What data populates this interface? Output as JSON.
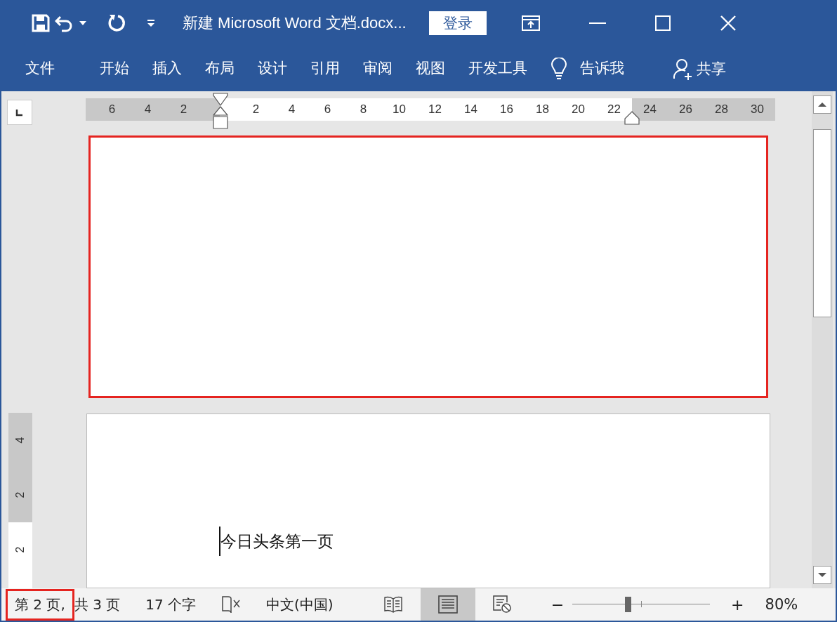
{
  "title_bar": {
    "title": "新建 Microsoft Word 文档.docx...",
    "sign_in": "登录"
  },
  "ribbon": {
    "tabs": [
      {
        "label": "文件",
        "selected": false
      },
      {
        "label": "开始",
        "selected": false
      },
      {
        "label": "插入",
        "selected": false
      },
      {
        "label": "布局",
        "selected": false
      },
      {
        "label": "设计",
        "selected": false
      },
      {
        "label": "引用",
        "selected": false
      },
      {
        "label": "审阅",
        "selected": false
      },
      {
        "label": "视图",
        "selected": false
      },
      {
        "label": "开发工具",
        "selected": false
      }
    ],
    "tell_me": "告诉我",
    "share": "共享"
  },
  "horizontal_ruler": {
    "labels": [
      {
        "text": "6",
        "in_margin": true
      },
      {
        "text": "4",
        "in_margin": true
      },
      {
        "text": "2",
        "in_margin": true
      },
      {
        "text": "2",
        "in_margin": false
      },
      {
        "text": "4",
        "in_margin": false
      },
      {
        "text": "6",
        "in_margin": false
      },
      {
        "text": "8",
        "in_margin": false
      },
      {
        "text": "10",
        "in_margin": false
      },
      {
        "text": "12",
        "in_margin": false
      },
      {
        "text": "14",
        "in_margin": false
      },
      {
        "text": "16",
        "in_margin": false
      },
      {
        "text": "18",
        "in_margin": false
      },
      {
        "text": "20",
        "in_margin": false
      },
      {
        "text": "22",
        "in_margin": false
      },
      {
        "text": "24",
        "in_margin": true
      },
      {
        "text": "26",
        "in_margin": true
      },
      {
        "text": "28",
        "in_margin": true
      },
      {
        "text": "30",
        "in_margin": true
      }
    ]
  },
  "vertical_ruler": {
    "labels": [
      {
        "text": "4",
        "in_margin": true
      },
      {
        "text": "2",
        "in_margin": true
      },
      {
        "text": "2",
        "in_margin": false
      }
    ]
  },
  "document": {
    "previous_page": {
      "highlighted": true
    },
    "current_page": {
      "text": "今日头条第一页"
    }
  },
  "status_bar": {
    "page": {
      "text": "第 2 页,",
      "highlighted": true
    },
    "total": "共 3 页",
    "words": "17 个字",
    "language": "中文(中国)",
    "views": [
      {
        "kind": "read",
        "selected": false
      },
      {
        "kind": "print",
        "selected": true
      },
      {
        "kind": "web",
        "selected": false
      }
    ],
    "zoom_out": "−",
    "zoom_in": "+",
    "zoom": {
      "level": 0.4
    },
    "zoom_text": "80%"
  }
}
